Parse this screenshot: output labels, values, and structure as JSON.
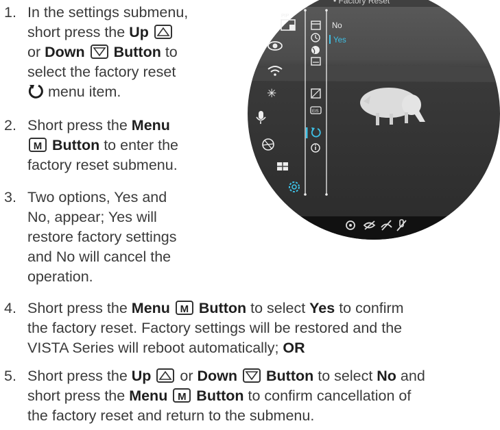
{
  "instructions": {
    "steps": [
      {
        "number": "1.",
        "lines": [
          "In the settings submenu,",
          "short press the ",
          "Up",
          "or ",
          "Down",
          "Button",
          " to",
          "select the factory reset",
          "menu item."
        ]
      },
      {
        "number": "2.",
        "lines": [
          "Short press the ",
          "Menu",
          "Button",
          " to enter the",
          "factory reset submenu."
        ]
      },
      {
        "number": "3.",
        "lines": [
          "Two options, Yes and",
          "No, appear; Yes will",
          "restore factory settings",
          "and No will cancel the",
          "operation."
        ]
      },
      {
        "number": "4.",
        "lines": [
          "Short press the ",
          "Menu",
          "Button",
          " to select ",
          "Yes",
          " to confirm",
          "the factory reset. Factory settings will be restored and the",
          "VISTA Series will reboot automatically; ",
          "OR"
        ]
      },
      {
        "number": "5.",
        "lines": [
          "Short press the ",
          "Up",
          " or ",
          "Down",
          "Button",
          " to select ",
          "No",
          " and",
          "short press the ",
          "Menu",
          "Button",
          " to confirm cancellation of",
          "the factory reset and return to the submenu."
        ]
      }
    ]
  },
  "keys": {
    "menu_key": "M"
  },
  "scope": {
    "header": "• Factory Reset",
    "option_no": "No",
    "option_yes": "Yes",
    "pip_label": "PIP",
    "eis_label": "EIS",
    "accent_color": "#3ec1e6"
  }
}
